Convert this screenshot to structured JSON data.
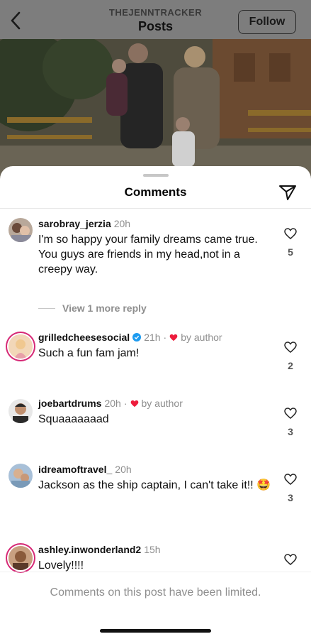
{
  "header": {
    "username": "THEJENNTRACKER",
    "title": "Posts",
    "follow_label": "Follow"
  },
  "sheet": {
    "title": "Comments"
  },
  "comments": [
    {
      "username": "sarobray_jerzia",
      "time": "20h",
      "text": "I'm so happy your family dreams came true. You guys are friends in my head,not in a creepy way.",
      "likes": "5",
      "view_replies": "View 1 more reply"
    },
    {
      "username": "grilledcheesesocial",
      "verified": true,
      "time": "21h",
      "author_like": "by author",
      "text": "Such a fun fam jam!",
      "likes": "2"
    },
    {
      "username": "joebartdrums",
      "time": "20h",
      "author_like": "by author",
      "text": "Squaaaaaaad",
      "likes": "3"
    },
    {
      "username": "idreamoftravel_",
      "time": "20h",
      "text": "Jackson as the ship captain, I can't take it!! 🤩",
      "likes": "3"
    },
    {
      "username": "ashley.inwonderland2",
      "time": "15h",
      "text": "Lovely!!!!"
    }
  ],
  "footer": {
    "limited_text": "Comments on this post have been limited."
  },
  "colors": {
    "heart_red": "#ed1c3c",
    "verified_blue": "#1d9bf0",
    "story_ring": "#d62976",
    "secondary_text": "#8e8e8e"
  },
  "icons": [
    "back-arrow-icon",
    "share-send-icon",
    "heart-outline-icon",
    "heart-filled-icon",
    "verified-badge-icon"
  ]
}
